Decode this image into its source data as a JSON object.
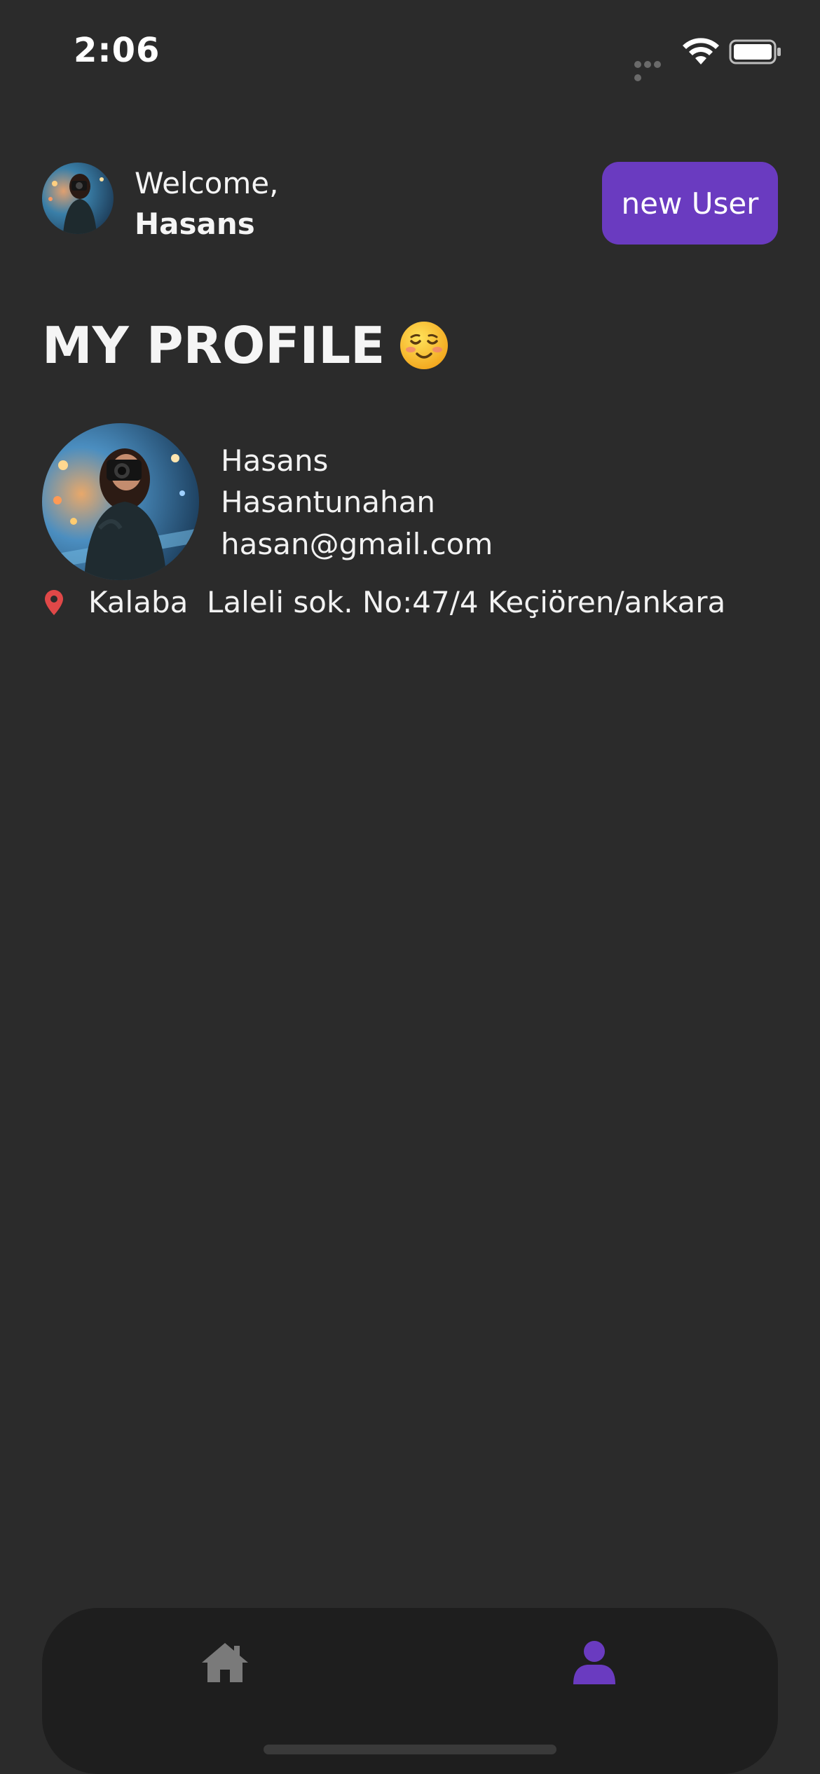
{
  "status_bar": {
    "time": "2:06"
  },
  "header": {
    "welcome_label": "Welcome,",
    "user_name": "Hasans",
    "new_user_button": "new User"
  },
  "page": {
    "title": "MY PROFILE"
  },
  "profile": {
    "first_name": "Hasans",
    "last_name": "Hasantunahan",
    "email": "hasan@gmail.com",
    "address": "Kalaba  Laleli sok. No:47/4 Keçiören/ankara"
  },
  "bottom_nav": {
    "items": [
      {
        "icon": "home-icon",
        "active": false
      },
      {
        "icon": "person-icon",
        "active": true
      }
    ]
  },
  "colors": {
    "background": "#2b2b2b",
    "accent": "#6a3bc0",
    "nav_background": "#1e1e1e",
    "location_pin": "#e04848",
    "inactive_icon": "#7a7a7a"
  }
}
